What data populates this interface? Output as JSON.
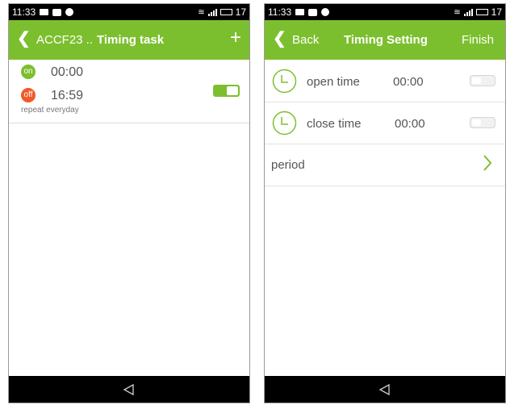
{
  "left_screen": {
    "status": {
      "time": "11:33",
      "battery_level": "17"
    },
    "appbar": {
      "device": "ACCF23 ..",
      "title": "Timing task",
      "add": "+"
    },
    "task": {
      "on_badge": "on",
      "on_time": "00:00",
      "off_badge": "off",
      "off_time": "16:59",
      "repeat": "repeat everyday",
      "enabled": true
    }
  },
  "right_screen": {
    "status": {
      "time": "11:33",
      "battery_level": "17"
    },
    "appbar": {
      "back": "Back",
      "title": "Timing Setting",
      "finish": "Finish"
    },
    "rows": [
      {
        "label": "open time",
        "time": "00:00",
        "enabled": false
      },
      {
        "label": "close time",
        "time": "00:00",
        "enabled": false
      }
    ],
    "period": {
      "label": "period"
    }
  },
  "colors": {
    "accent": "#7cbf2e",
    "off_badge": "#f05a28",
    "bar": "#000000"
  },
  "icons": [
    "back-chevron-icon",
    "add-icon",
    "clock-icon",
    "chevron-right-icon",
    "nav-back-icon",
    "wifi-icon",
    "signal-icon",
    "battery-icon"
  ]
}
